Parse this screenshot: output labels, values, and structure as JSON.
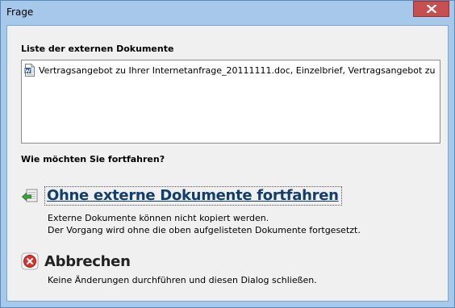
{
  "window": {
    "title": "Frage"
  },
  "documents": {
    "label": "Liste der externen Dokumente",
    "items": [
      {
        "text": "Vertragsangebot zu Ihrer Internetanfrage_20111111.doc, Einzelbrief, Vertragsangebot zu Ihrer ...",
        "icon": "word-document-icon"
      }
    ]
  },
  "question": {
    "label": "Wie möchten Sie fortfahren?"
  },
  "options": [
    {
      "title": "Ohne externe Dokumente fortfahren",
      "icon": "continue-arrow-icon",
      "lines": [
        "Externe Dokumente können nicht kopiert werden.",
        "Der Vorgang wird ohne die oben aufgelisteten Dokumente fortgesetzt."
      ]
    },
    {
      "title": "Abbrechen",
      "icon": "cancel-x-icon",
      "lines": [
        "Keine Änderungen durchführen und diesen Dialog schließen."
      ]
    }
  ],
  "colors": {
    "title_bar": "#a6c8ea",
    "close_button": "#c74f4f",
    "link_text": "#123e6e",
    "cancel_icon": "#d9342b"
  }
}
